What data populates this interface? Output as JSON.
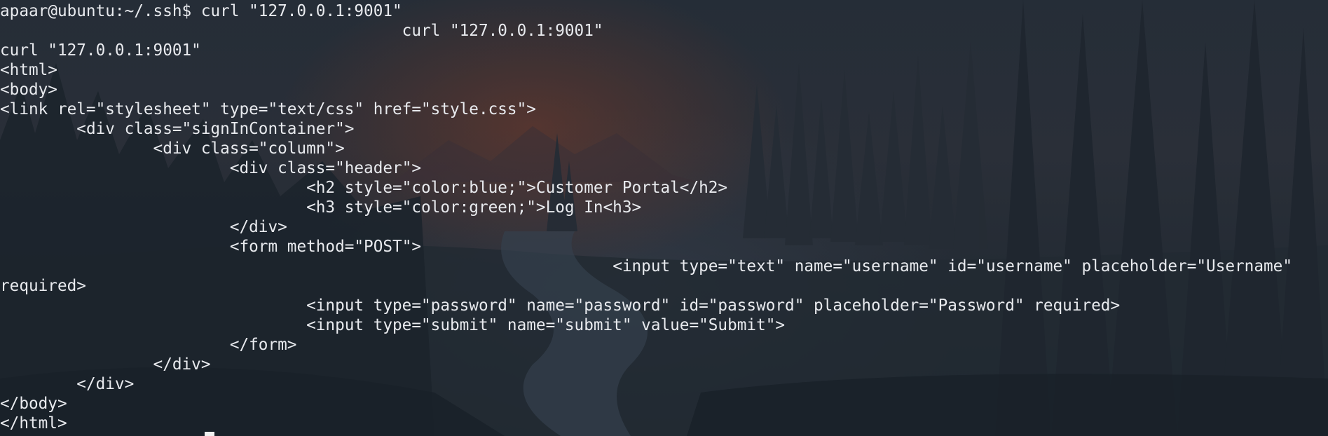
{
  "terminal": {
    "lines": [
      "apaar@ubuntu:~/.ssh$ curl \"127.0.0.1:9001\"",
      "                                          curl \"127.0.0.1:9001\"",
      "curl \"127.0.0.1:9001\"",
      "<html>",
      "<body>",
      "<link rel=\"stylesheet\" type=\"text/css\" href=\"style.css\">",
      "\t<div class=\"signInContainer\">",
      "\t\t<div class=\"column\">",
      "\t\t\t<div class=\"header\">",
      "\t\t\t\t<h2 style=\"color:blue;\">Customer Portal</h2>",
      "\t\t\t\t<h3 style=\"color:green;\">Log In<h3>",
      "\t\t\t</div>",
      "\t\t\t<form method=\"POST\">",
      "\t\t\t\t\t\t\t\t<input type=\"text\" name=\"username\" id=\"username\" placeholder=\"Username\"",
      "required>",
      "\t\t\t\t<input type=\"password\" name=\"password\" id=\"password\" placeholder=\"Password\" required>",
      "\t\t\t\t<input type=\"submit\" name=\"submit\" value=\"Submit\">",
      "\t\t\t</form>",
      "\t\t</div>",
      "\t</div>",
      "</body>",
      "</html>"
    ]
  }
}
